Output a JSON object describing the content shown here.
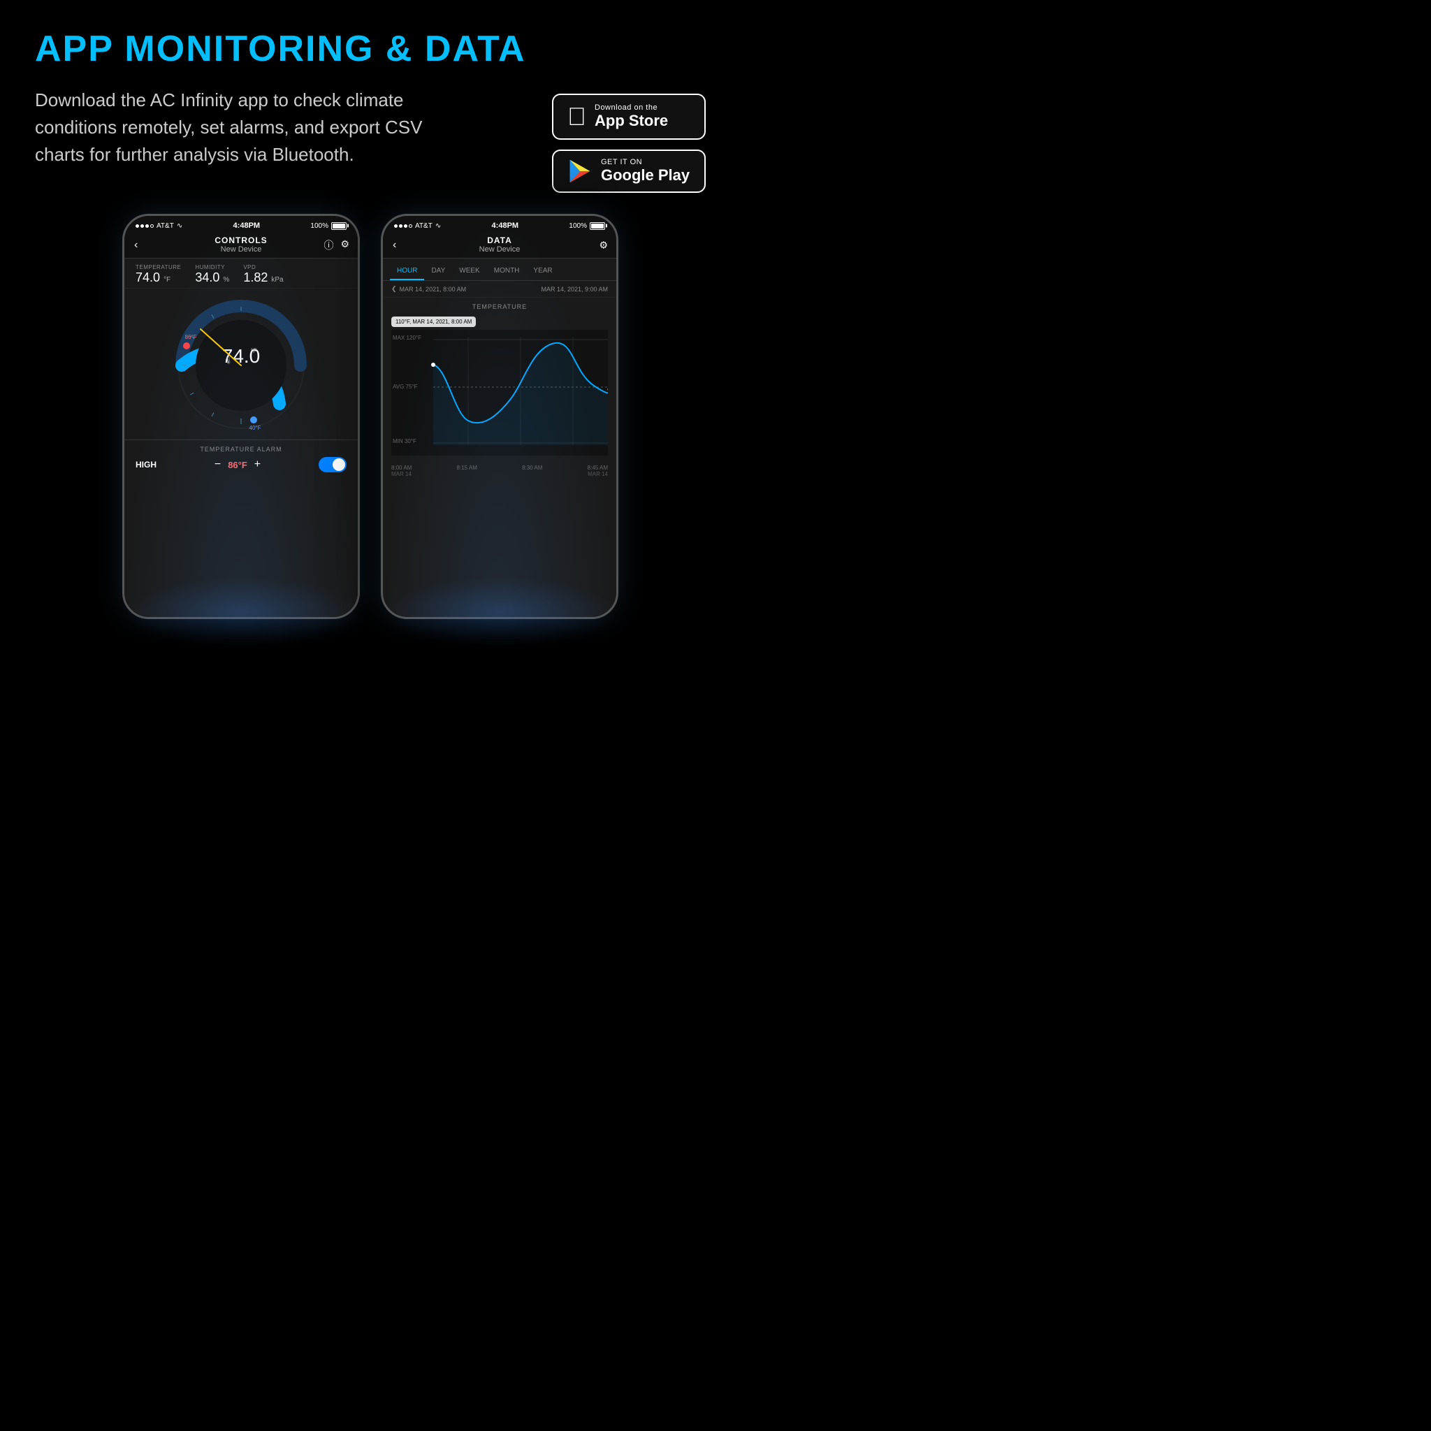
{
  "page": {
    "title": "APP MONITORING & DATA",
    "description": "Download the AC Infinity app to check climate conditions remotely, set alarms, and export CSV charts for further analysis via Bluetooth.",
    "background_color": "#000000"
  },
  "badges": {
    "appstore": {
      "small_text": "Download on the",
      "large_text": "App Store"
    },
    "googleplay": {
      "small_text": "GET IT ON",
      "large_text": "Google Play"
    }
  },
  "phone_controls": {
    "status_bar": {
      "carrier": "AT&T",
      "time": "4:48PM",
      "battery": "100%"
    },
    "header": {
      "title": "CONTROLS",
      "subtitle": "New Device"
    },
    "stats": {
      "temperature": {
        "label": "TEMPERATURE",
        "value": "74.0",
        "unit": "°F"
      },
      "humidity": {
        "label": "HUMIDITY",
        "value": "34.0",
        "unit": "%"
      },
      "vpd": {
        "label": "VPD",
        "value": "1.82",
        "unit": "kPa"
      }
    },
    "gauge": {
      "value": "74.0",
      "unit": "°F",
      "max_label": "86°F",
      "min_label": "40°F"
    },
    "alarm": {
      "section_title": "TEMPERATURE ALARM",
      "high_label": "HIGH",
      "value": "86°F"
    }
  },
  "phone_data": {
    "status_bar": {
      "carrier": "AT&T",
      "time": "4:48PM",
      "battery": "100%"
    },
    "header": {
      "title": "DATA",
      "subtitle": "New Device"
    },
    "tabs": [
      "HOUR",
      "DAY",
      "WEEK",
      "MONTH",
      "YEAR"
    ],
    "active_tab": "HOUR",
    "date_range": {
      "start": "MAR 14, 2021, 8:00 AM",
      "end": "MAR 14, 2021, 9:00 AM"
    },
    "chart": {
      "title": "TEMPERATURE",
      "tooltip": "110°F, MAR 14, 2021, 8:00 AM",
      "y_labels": {
        "max": "MAX 120°F",
        "avg": "AVG 75°F",
        "min": "MIN 30°F"
      }
    },
    "time_labels": [
      "8:00 AM",
      "8:15 AM",
      "8:30 AM",
      "8:45 AM"
    ],
    "date_labels": [
      "MAR 14",
      "",
      "",
      "MAR 14"
    ]
  }
}
